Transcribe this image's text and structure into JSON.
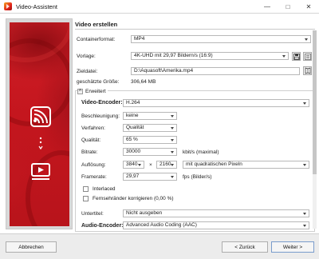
{
  "window": {
    "title": "Video-Assistent"
  },
  "section": {
    "title": "Video erstellen"
  },
  "rows": {
    "container_label": "Containerformat:",
    "container_value": "MP4",
    "preset_label": "Vorlage:",
    "preset_value": "4K-UHD mit 29,97 Bildern/s (16:9)",
    "target_label": "Zieldatei:",
    "target_value": "D:\\Aquasoft\\Amerika.mp4",
    "size_label": "geschätzte Größe:",
    "size_value": "306,64 MB"
  },
  "advanced": {
    "toggle_label": "Erweitert",
    "video_encoder_label": "Video-Encoder:",
    "video_encoder_value": "H.264",
    "acceleration_label": "Beschleunigung:",
    "acceleration_value": "keine",
    "method_label": "Verfahren:",
    "method_value": "Qualität",
    "quality_label": "Qualität:",
    "quality_value": "65 %",
    "bitrate_label": "Bitrate:",
    "bitrate_value": "30000",
    "bitrate_unit": "kbit/s (maximal)",
    "resolution_label": "Auflösung:",
    "res_width": "3840",
    "res_x": "×",
    "res_height": "2160",
    "pixel_mode": "mit quadratischen Pixeln",
    "framerate_label": "Framerate:",
    "framerate_value": "29,97",
    "framerate_unit": "fps (Bilder/s)",
    "interlaced_label": "Interlaced",
    "overscan_label": "Fernsehränder korrigieren (0,00 %)",
    "subtitle_label": "Untertitel:",
    "subtitle_value": "Nicht ausgeben",
    "audio_encoder_label": "Audio-Encoder:",
    "audio_encoder_value": "Advanced Audio Coding (AAC)"
  },
  "buttons": {
    "cancel": "Abbrechen",
    "back": "< Zurück",
    "next": "Weiter >"
  },
  "colors": {
    "accent_red": "#d01f27",
    "panel_gray": "#d8d8d8"
  }
}
